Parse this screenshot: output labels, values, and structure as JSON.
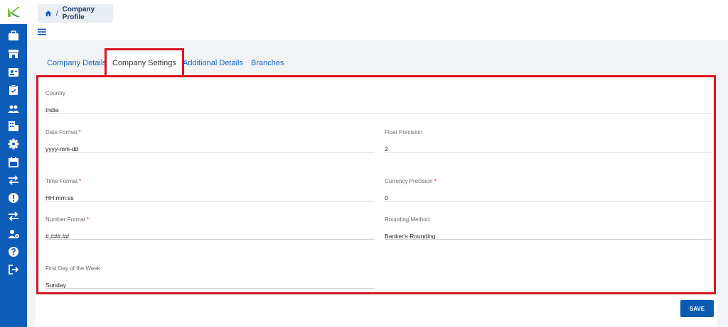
{
  "breadcrumb": {
    "separator": "/",
    "current": "Company Profile"
  },
  "sidebar": {
    "icons": [
      "briefcase-icon",
      "store-icon",
      "id-card-icon",
      "clipboard-check-icon",
      "people-icon",
      "building-icon",
      "gear-icon",
      "calendar-icon",
      "transfer-icon",
      "alert-icon",
      "transfer-icon",
      "user-gear-icon",
      "help-icon",
      "logout-icon"
    ]
  },
  "tabs": [
    {
      "label": "Company Details"
    },
    {
      "label": "Company Settings"
    },
    {
      "label": "Additional Details"
    },
    {
      "label": "Branches"
    }
  ],
  "form": {
    "country": {
      "label": "Country",
      "value": "India"
    },
    "date_format": {
      "label": "Date Format",
      "required": "*",
      "value": "yyyy-mm-dd"
    },
    "float_precision": {
      "label": "Float Precision",
      "value": "2"
    },
    "time_format": {
      "label": "Time Format",
      "required": "*",
      "value": "HH:mm:ss"
    },
    "currency_precision": {
      "label": "Currency Precision",
      "required": "*",
      "value": "0"
    },
    "number_format": {
      "label": "Number Format",
      "required": "*",
      "value": "#,###.##"
    },
    "rounding_method": {
      "label": "Rounding Method",
      "value": "Banker's Rounding"
    },
    "first_day": {
      "label": "First Day of the Week",
      "value": "Sunday"
    }
  },
  "save_label": "SAVE",
  "colors": {
    "sidebar": "#0d5db8",
    "accent": "#1466c4",
    "highlight": "#d9141f",
    "button": "#0b5bb0"
  }
}
